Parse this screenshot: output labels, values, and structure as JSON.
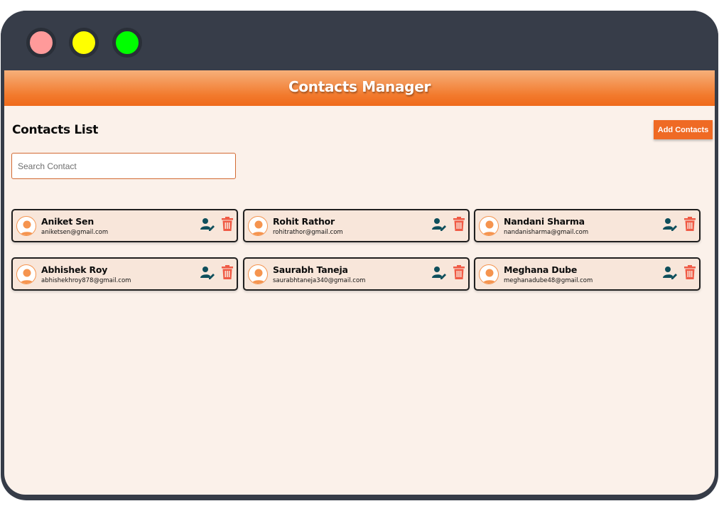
{
  "window": {
    "controls": [
      {
        "name": "close",
        "color": "#ff9a9a"
      },
      {
        "name": "minimize",
        "color": "#ffff00"
      },
      {
        "name": "maximize",
        "color": "#00ff00"
      }
    ]
  },
  "header": {
    "title": "Contacts Manager"
  },
  "page": {
    "title": "Contacts List",
    "add_button_label": "Add Contacts"
  },
  "search": {
    "placeholder": "Search Contact",
    "value": ""
  },
  "colors": {
    "accent": "#ef6a24",
    "edit_icon": "#0f4f5c",
    "delete_icon": "#f05a45"
  },
  "contacts": [
    {
      "name": "Aniket Sen",
      "email": "aniketsen@gmail.com",
      "edit_icon": "user-edit-icon",
      "delete_icon": "trash-icon"
    },
    {
      "name": "Rohit Rathor",
      "email": "rohitrathor@gmail.com",
      "edit_icon": "user-edit-icon",
      "delete_icon": "trash-icon"
    },
    {
      "name": "Nandani Sharma",
      "email": "nandanisharma@gmail.com",
      "edit_icon": "user-edit-icon",
      "delete_icon": "trash-icon"
    },
    {
      "name": "Abhishek Roy",
      "email": "abhishekhroy878@gmail.com",
      "edit_icon": "user-edit-icon",
      "delete_icon": "trash-icon"
    },
    {
      "name": "Saurabh Taneja",
      "email": "saurabhtaneja340@gmail.com",
      "edit_icon": "user-edit-icon",
      "delete_icon": "trash-icon"
    },
    {
      "name": "Meghana Dube",
      "email": "meghanadube48@gmail.com",
      "edit_icon": "user-edit-icon",
      "delete_icon": "trash-icon"
    }
  ]
}
